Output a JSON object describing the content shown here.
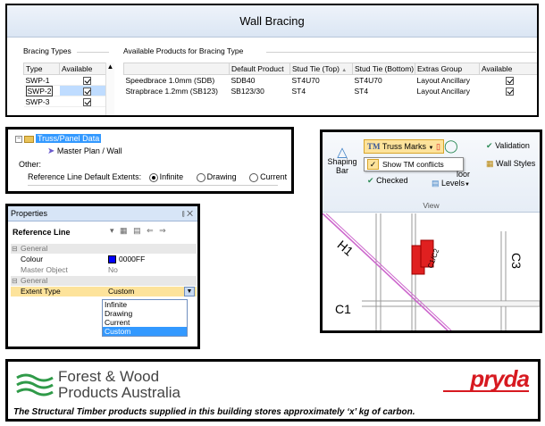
{
  "wall_bracing": {
    "title": "Wall Bracing",
    "bracing_types_label": "Bracing Types",
    "available_products_label": "Available Products for Bracing Type",
    "types_columns": [
      "Type",
      "Available"
    ],
    "types": [
      {
        "type": "SWP-1",
        "available": true
      },
      {
        "type": "SWP-2",
        "available": true,
        "selected": true
      },
      {
        "type": "SWP-3",
        "available": true
      }
    ],
    "products_columns": [
      "",
      "Default Product",
      "Stud Tie (Top)",
      "Stud Tie (Bottom)",
      "Extras Group",
      "Available"
    ],
    "products": [
      {
        "name": "Speedbrace 1.0mm (SDB)",
        "default_product": "SDB40",
        "stud_tie_top": "ST4U70",
        "stud_tie_bottom": "ST4U70",
        "extras_group": "Layout Ancillary",
        "available": true
      },
      {
        "name": "Strapbrace 1.2mm (SB123)",
        "default_product": "SB123/30",
        "stud_tie_top": "ST4",
        "stud_tie_bottom": "ST4",
        "extras_group": "Layout Ancillary",
        "available": true
      }
    ]
  },
  "tree": {
    "root": "Truss/Panel Data",
    "child": "Master Plan / Wall",
    "other_label": "Other:",
    "extents_label": "Reference Line Default Extents:",
    "options": [
      "Infinite",
      "Drawing",
      "Current"
    ],
    "selected_option": "Infinite"
  },
  "properties": {
    "title": "Properties",
    "pin_close": "⫾ ✕",
    "object": "Reference Line",
    "rows": [
      {
        "kind": "category",
        "key": "General"
      },
      {
        "kind": "prop",
        "key": "Colour",
        "value": "0000FF",
        "swatch": "#0000ff"
      },
      {
        "kind": "prop",
        "key": "Master Object",
        "value": "No",
        "muted": true
      },
      {
        "kind": "category",
        "key": "General"
      },
      {
        "kind": "prop",
        "key": "Extent Type",
        "value": "Custom",
        "selected": true
      }
    ],
    "dropdown_options": [
      "Infinite",
      "Drawing",
      "Current",
      "Custom"
    ],
    "dropdown_highlight": "Custom"
  },
  "ribbon": {
    "truss_marks": "Truss Marks",
    "show_tm_conflicts": "Show TM conflicts",
    "shaping_bar": "Shaping\nBar",
    "checked": "Checked",
    "floor": "loor",
    "levels": "Levels",
    "validation": "Validation",
    "wall_styles": "Wall Styles",
    "group_label": "View"
  },
  "drawing": {
    "labels": [
      "H1",
      "C3",
      "C1",
      "C1/C2"
    ],
    "colors": {
      "diag": "#cc66cc",
      "grid": "#999999",
      "truss": "#e02020"
    }
  },
  "footer": {
    "org_line1": "Forest & Wood",
    "org_line2": "Products Australia",
    "brand": "pryda",
    "carbon_text": "The Structural Timber products supplied in this building stores approximately ‘x’ kg of carbon."
  }
}
